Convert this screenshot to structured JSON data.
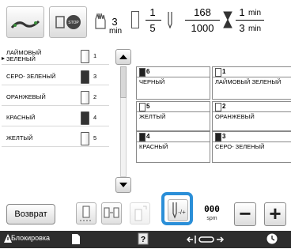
{
  "status": {
    "time1_value": "3",
    "time1_unit": "min",
    "thread_pos_num": "1",
    "thread_pos_den": "5",
    "stitch_current": "168",
    "stitch_total": "1000",
    "time2_top": "1",
    "time2_bottom": "3",
    "time2_unit": "min"
  },
  "thread_list": [
    {
      "label": "ЛАЙМОВЫЙ ЗЕЛЕНЫЙ",
      "num": "1",
      "spool": "lime"
    },
    {
      "label": "СЕРО- ЗЕЛЕНЫЙ",
      "num": "3",
      "spool": "dark"
    },
    {
      "label": "ОРАНЖЕВЫЙ",
      "num": "2",
      "spool": "light"
    },
    {
      "label": "КРАСНЫЙ",
      "num": "4",
      "spool": "dark"
    },
    {
      "label": "ЖЕЛТЫЙ",
      "num": "5",
      "spool": "light"
    }
  ],
  "grid": [
    {
      "num": "6",
      "name": "ЧЕРНЫЙ",
      "dark": true
    },
    {
      "num": "1",
      "name": "ЛАЙМОВЫЙ ЗЕЛЕНЫЙ",
      "dark": false
    },
    {
      "num": "5",
      "name": "ЖЕЛТЫЙ",
      "dark": false
    },
    {
      "num": "2",
      "name": "ОРАНЖЕВЫЙ",
      "dark": false
    },
    {
      "num": "4",
      "name": "КРАСНЫЙ",
      "dark": true
    },
    {
      "num": "3",
      "name": "СЕРО- ЗЕЛЕНЫЙ",
      "dark": true
    }
  ],
  "controls": {
    "back_label": "Возврат",
    "speed_value": "000",
    "speed_unit": "spm",
    "minus_label": "−",
    "plus_label": "+"
  },
  "bottombar": {
    "lock_label": "Блокировка"
  },
  "colors": {
    "highlight": "#2b8fd8",
    "bar": "#2d2d2d"
  }
}
